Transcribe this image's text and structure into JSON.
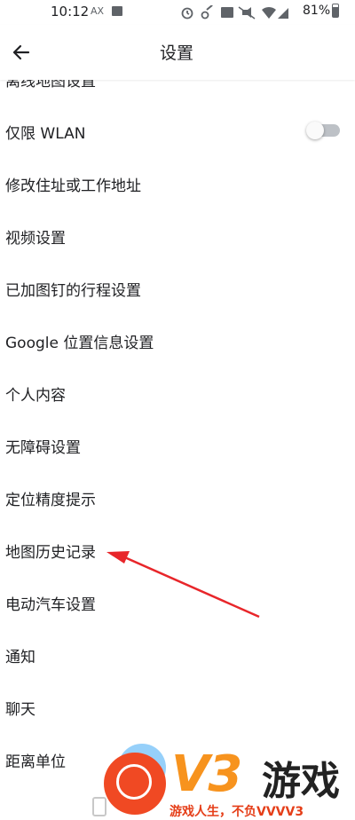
{
  "status_bar": {
    "time": "10:12",
    "indicator_text": "AX",
    "battery": "81%",
    "icons": [
      "image-icon",
      "alarm-icon",
      "key-icon",
      "volte-icon",
      "mute-icon",
      "wifi-icon",
      "signal-4g-icon",
      "battery-icon"
    ]
  },
  "app_bar": {
    "back_icon": "arrow-left-icon",
    "title": "设置"
  },
  "settings": {
    "items": [
      {
        "label": "离线地图设置"
      },
      {
        "label": "仅限 WLAN",
        "toggle": false
      },
      {
        "label": "修改住址或工作地址"
      },
      {
        "label": "视频设置"
      },
      {
        "label": "已加图钉的行程设置"
      },
      {
        "label": "Google 位置信息设置"
      },
      {
        "label": "个人内容"
      },
      {
        "label": "无障碍设置"
      },
      {
        "label": "定位精度提示"
      },
      {
        "label": "地图历史记录"
      },
      {
        "label": "电动汽车设置"
      },
      {
        "label": "通知"
      },
      {
        "label": "聊天"
      },
      {
        "label": "距离单位"
      }
    ]
  },
  "annotation": {
    "color": "#e8262a",
    "target": "地图历史记录"
  },
  "watermark": {
    "brand": "V3",
    "name": "游戏",
    "slogan": "游戏人生，不负VVVV3"
  },
  "colors": {
    "accent": "#f7931e",
    "toggle_off_track": "#bdc1c6",
    "arrow": "#e8262a"
  }
}
